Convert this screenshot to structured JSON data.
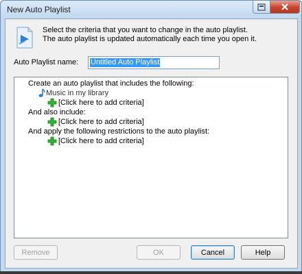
{
  "window": {
    "title": "New Auto Playlist"
  },
  "header": {
    "line1": "Select the criteria that you want to change in the auto playlist.",
    "line2": "The auto playlist is updated automatically each time you open it."
  },
  "name_field": {
    "label": "Auto Playlist name:",
    "value": "Untitled Auto Playlist"
  },
  "criteria": {
    "section1": "Create an auto playlist that includes the following:",
    "library_item": "Music in my library",
    "add_link1": "[Click here to add criteria]",
    "section2": "And also include:",
    "add_link2": "[Click here to add criteria]",
    "section3": "And apply the following restrictions to the auto playlist:",
    "add_link3": "[Click here to add criteria]"
  },
  "buttons": {
    "remove": "Remove",
    "ok": "OK",
    "cancel": "Cancel",
    "help": "Help"
  },
  "colors": {
    "accent": "#3399ff",
    "plus_green": "#2fb52f",
    "close_red": "#c9432b"
  }
}
